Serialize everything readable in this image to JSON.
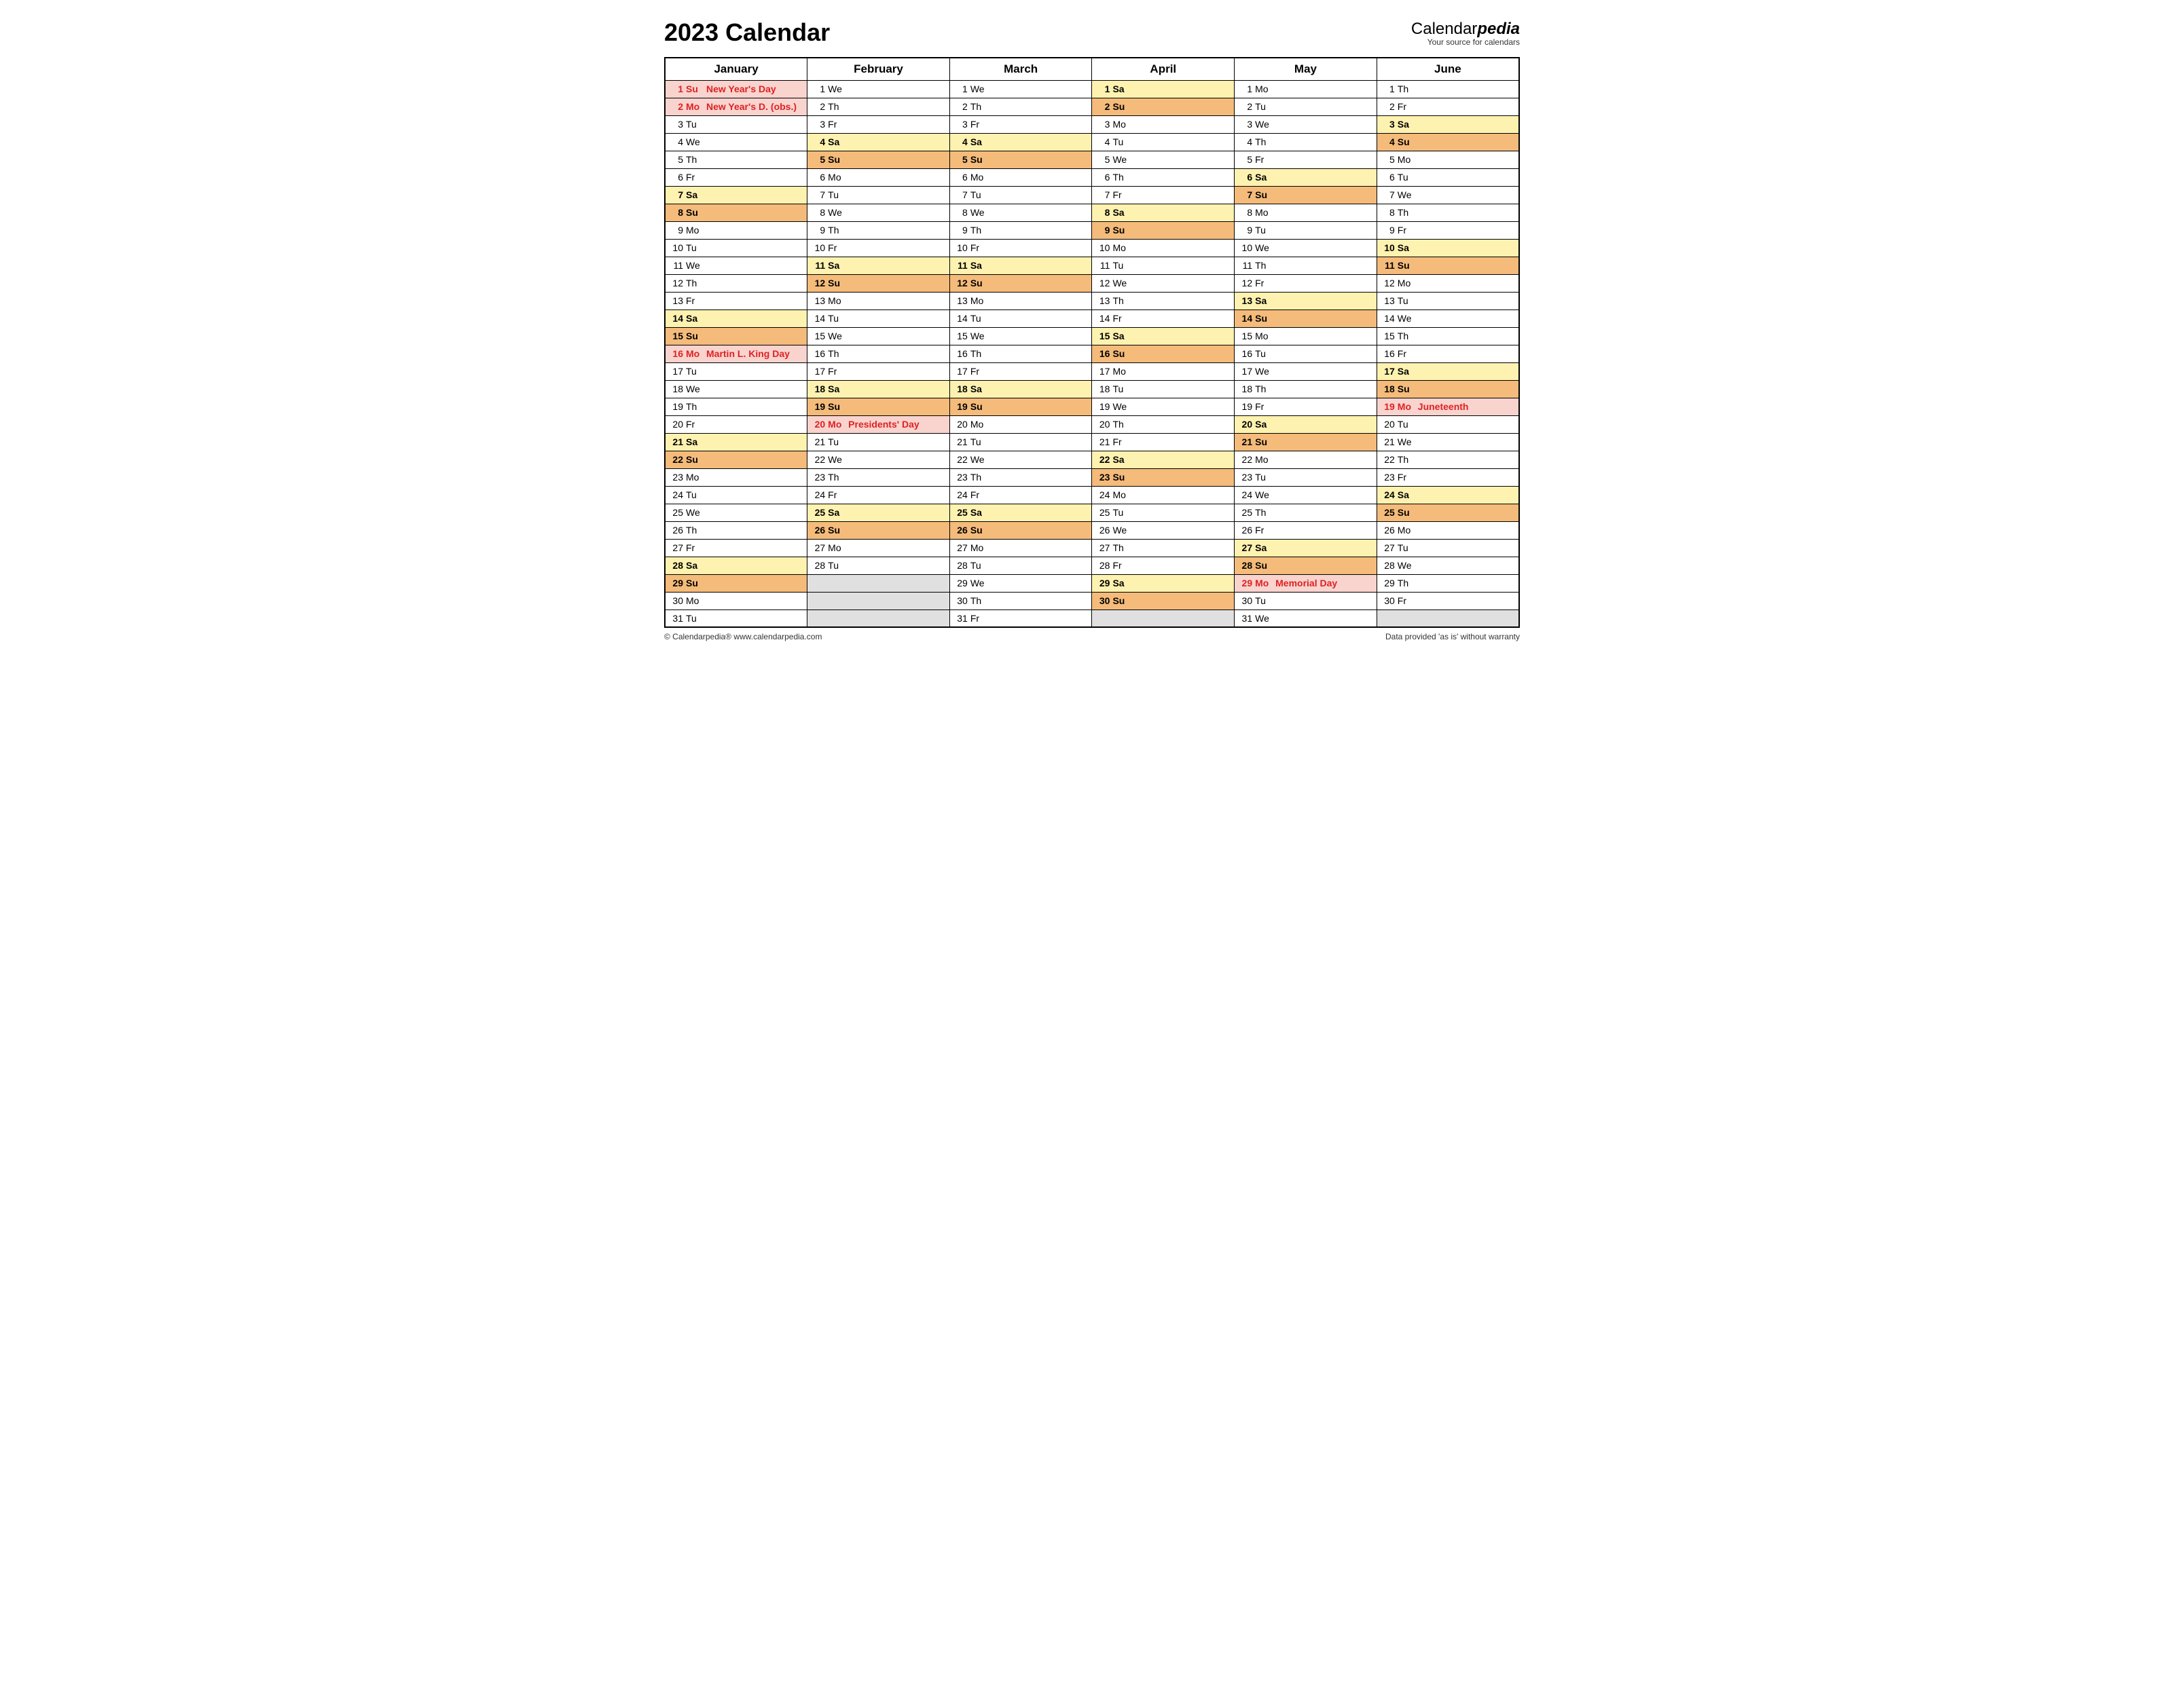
{
  "title": "2023 Calendar",
  "logo": {
    "brand_plain": "Calendar",
    "brand_bold": "pedia",
    "tagline": "Your source for calendars"
  },
  "footer_left": "© Calendarpedia®   www.calendarpedia.com",
  "footer_right": "Data provided 'as is' without warranty",
  "months": [
    "January",
    "February",
    "March",
    "April",
    "May",
    "June"
  ],
  "month_lengths": [
    31,
    28,
    31,
    30,
    31,
    30
  ],
  "start_dow": [
    0,
    3,
    3,
    6,
    1,
    4
  ],
  "dow_short": [
    "Su",
    "Mo",
    "Tu",
    "We",
    "Th",
    "Fr",
    "Sa"
  ],
  "holidays": {
    "0": {
      "1": "New Year's Day",
      "2": "New Year's D. (obs.)",
      "16": "Martin L. King Day"
    },
    "1": {
      "20": "Presidents' Day"
    },
    "4": {
      "29": "Memorial Day"
    },
    "5": {
      "19": "Juneteenth"
    }
  },
  "max_rows": 31
}
